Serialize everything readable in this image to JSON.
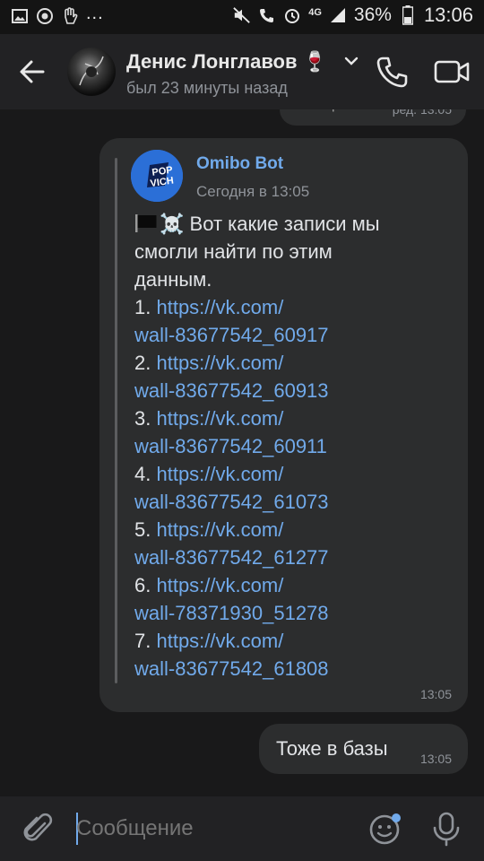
{
  "status_bar": {
    "battery": "36%",
    "time": "13:06",
    "network": "4G",
    "left_icons": [
      "image-icon",
      "sync-icon",
      "hand-icon"
    ],
    "left_more": "..."
  },
  "header": {
    "name": "Денис Лонглавов",
    "name_extra": "🍷",
    "last_seen": "был 23 минуты назад"
  },
  "prev_message": {
    "partial_text": "р",
    "edited_time": "ред. 13:05"
  },
  "forwarded": {
    "bot_name": "Omibo Bot",
    "date": "Сегодня в 13:05",
    "avatar_text": [
      "POP",
      "VICH"
    ],
    "intro_emoji": "☠️",
    "intro_lines": [
      " Вот какие записи мы",
      "смогли найти по этим",
      "данным."
    ],
    "links": [
      {
        "num": "1.",
        "line1": "https://vk.com/",
        "line2": "wall-83677542_60917"
      },
      {
        "num": "2.",
        "line1": "https://vk.com/",
        "line2": "wall-83677542_60913"
      },
      {
        "num": "3.",
        "line1": "https://vk.com/",
        "line2": "wall-83677542_60911"
      },
      {
        "num": "4.",
        "line1": "https://vk.com/",
        "line2": "wall-83677542_61073"
      },
      {
        "num": "5.",
        "line1": "https://vk.com/",
        "line2": "wall-83677542_61277"
      },
      {
        "num": "6.",
        "line1": "https://vk.com/",
        "line2": "wall-78371930_51278"
      },
      {
        "num": "7.",
        "line1": "https://vk.com/",
        "line2": "wall-83677542_61808"
      }
    ],
    "time": "13:05"
  },
  "outgoing": {
    "text": "Тоже в базы",
    "time": "13:05"
  },
  "composer": {
    "placeholder": "Сообщение"
  },
  "colors": {
    "background": "#19191a",
    "bubble": "#2c2d2e",
    "link": "#71aaeb",
    "accent": "#71aaeb"
  }
}
